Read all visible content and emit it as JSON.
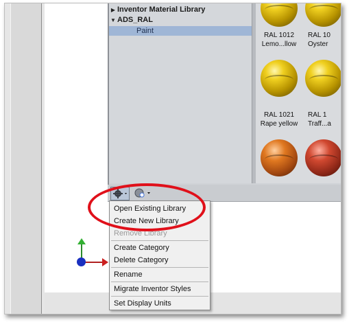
{
  "tree": {
    "items": [
      {
        "label": "Inventor Material Library",
        "expanded": false
      },
      {
        "label": "ADS_RAL",
        "expanded": true
      },
      {
        "label": "Paint",
        "selected": true
      }
    ]
  },
  "swatches": [
    {
      "code": "RAL 1012",
      "name": "Lemo...llow",
      "color": "yellow"
    },
    {
      "code": "RAL 10",
      "name": "Oyster",
      "color": "yellow"
    },
    {
      "code": "RAL 1021",
      "name": "Rape yellow",
      "color": "yellow"
    },
    {
      "code": "RAL 1",
      "name": "Traff...a",
      "color": "yellow"
    },
    {
      "code": "",
      "name": "",
      "color": "orange"
    },
    {
      "code": "",
      "name": "",
      "color": "red"
    }
  ],
  "toolbar": {
    "gear_icon": "gear-icon",
    "add_material_icon": "add-material-icon"
  },
  "menu": {
    "items": [
      {
        "label": "Open Existing Library",
        "enabled": true
      },
      {
        "label": "Create New Library",
        "enabled": true
      },
      {
        "label": "Remove Library",
        "enabled": false
      },
      {
        "label": "Create Category",
        "enabled": true
      },
      {
        "label": "Delete Category",
        "enabled": true
      },
      {
        "label": "Rename",
        "enabled": true
      },
      {
        "label": "Migrate Inventor Styles",
        "enabled": true
      },
      {
        "label": "Set Display Units",
        "enabled": true
      }
    ]
  },
  "colors": {
    "highlight": "#e0101a",
    "selection": "#9fb6d6"
  }
}
